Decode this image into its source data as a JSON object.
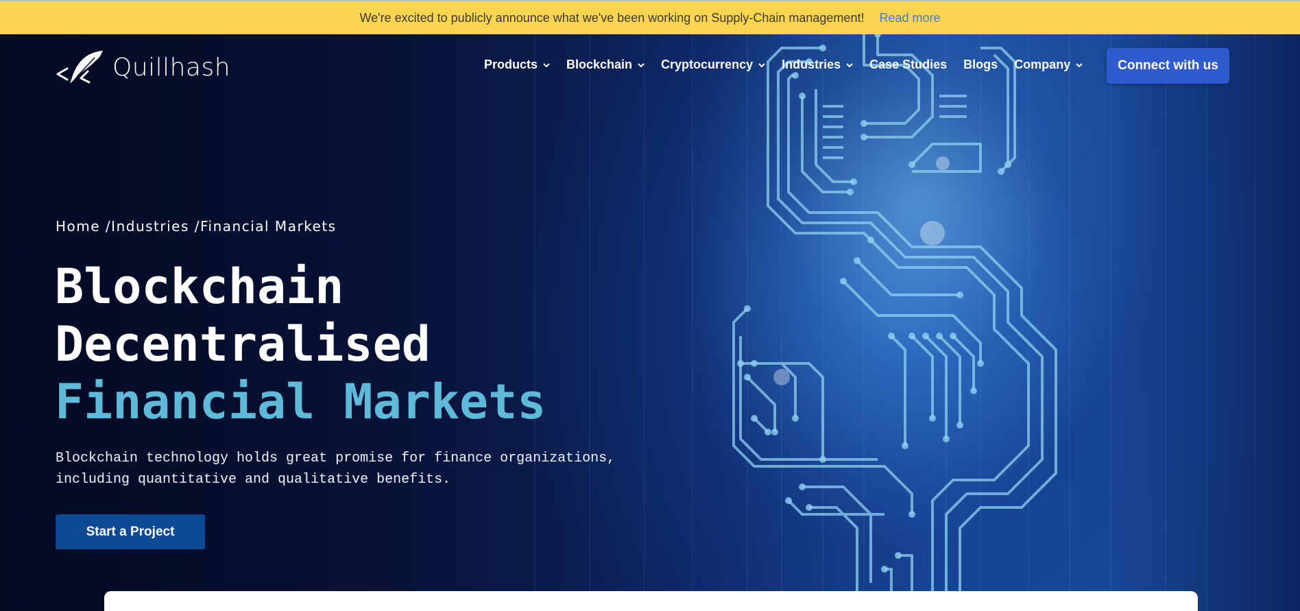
{
  "announcement": {
    "text": "We're excited to publicly announce what we've been working on Supply-Chain management!",
    "link_label": "Read more"
  },
  "brand": {
    "name": "Quillhash"
  },
  "nav": {
    "items": [
      {
        "label": "Products",
        "has_dropdown": true
      },
      {
        "label": "Blockchain",
        "has_dropdown": true
      },
      {
        "label": "Cryptocurrency",
        "has_dropdown": true
      },
      {
        "label": "Industries",
        "has_dropdown": true
      },
      {
        "label": "Case Studies",
        "has_dropdown": false
      },
      {
        "label": "Blogs",
        "has_dropdown": false
      },
      {
        "label": "Company",
        "has_dropdown": true
      }
    ],
    "cta_label": "Connect with us"
  },
  "breadcrumb": {
    "items": [
      "Home",
      "Industries",
      "Financial Markets"
    ],
    "separator": " /"
  },
  "hero": {
    "title_line1": "Blockchain",
    "title_line2": "Decentralised",
    "title_accent": "Financial Markets",
    "subtitle_line1": "Blockchain technology holds great promise for finance organizations,",
    "subtitle_line2": "including quantitative and qualitative benefits.",
    "cta_label": "Start a Project"
  },
  "colors": {
    "announcement_bg": "#fbd451",
    "link": "#3f7fd6",
    "accent": "#5fb9d9",
    "connect_button": "#2f5bd0",
    "start_button": "#0c4a96",
    "hero_dark": "#050b24"
  }
}
